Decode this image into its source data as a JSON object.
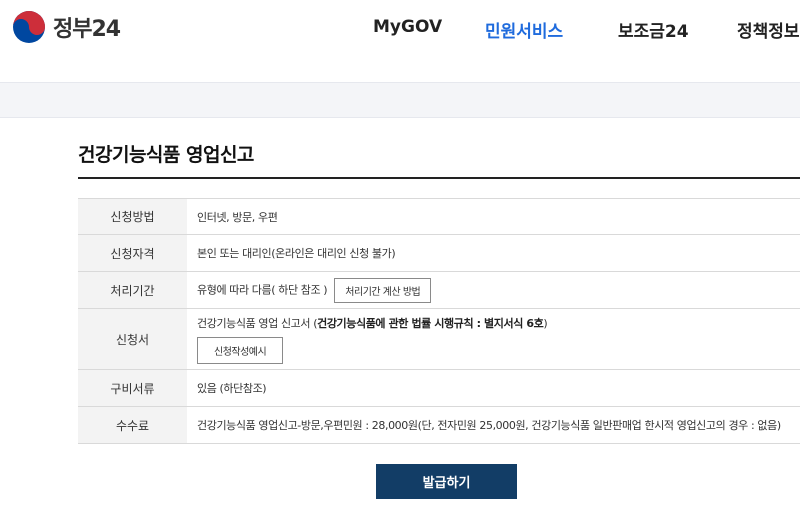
{
  "header": {
    "logo_text": "정부24",
    "nav": [
      {
        "label": "MyGOV",
        "active": false
      },
      {
        "label": "민원서비스",
        "active": true
      },
      {
        "label": "보조금24",
        "active": false
      },
      {
        "label": "정책정보",
        "active": false
      }
    ]
  },
  "page": {
    "title": "건강기능식품 영업신고"
  },
  "info": {
    "method": {
      "label": "신청방법",
      "value": "인터넷, 방문, 우편"
    },
    "qualification": {
      "label": "신청자격",
      "value": "본인 또는 대리인(온라인은 대리인 신청 불가)"
    },
    "period": {
      "label": "처리기간",
      "value": "유형에 따라 다름( 하단 참조 )",
      "button": "처리기간 계산 방법"
    },
    "form": {
      "label": "신청서",
      "value_prefix": "건강기능식품 영업 신고서 (",
      "value_bold": "건강기능식품에 관한 법률 시행규칙 : 별지서식 6호",
      "value_suffix": ")",
      "button": "신청작성예시"
    },
    "documents": {
      "label": "구비서류",
      "value": "있음 (하단참조)"
    },
    "fee": {
      "label": "수수료",
      "value": "건강기능식품 영업신고-방문,우편민원 : 28,000원(단, 전자민원 25,000원, 건강기능식품 일반판매업 한시적 영업신고의 경우 : 없음)"
    }
  },
  "actions": {
    "issue_label": "발급하기"
  },
  "colors": {
    "brand_navy": "#123d66",
    "nav_active": "#1f6bdd",
    "emblem_red": "#cd2e3a",
    "emblem_blue": "#0047a0"
  }
}
